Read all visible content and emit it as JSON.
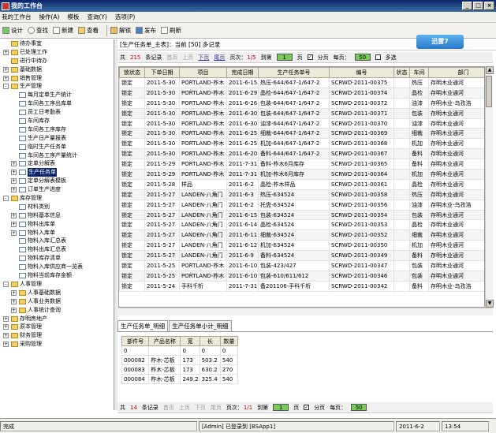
{
  "window": {
    "title": "我的工作台"
  },
  "menu": [
    "我的工作台",
    "操作(A)",
    "模板",
    "查询(Y)",
    "选项(P)"
  ],
  "toolbar": {
    "buttons": [
      {
        "label": "设计",
        "icon": "design-icon"
      },
      {
        "label": "查找",
        "icon": "search-icon"
      },
      {
        "label": "新建",
        "icon": "new-doc-icon"
      },
      {
        "label": "查看",
        "icon": "view-icon"
      }
    ],
    "buttons2": [
      {
        "label": "解锁",
        "icon": "unlock-icon"
      },
      {
        "label": "发布",
        "icon": "publish-icon"
      },
      {
        "label": "刷新",
        "icon": "refresh-icon"
      }
    ]
  },
  "sidebar": {
    "items": [
      {
        "label": "待办事宜",
        "level": 0,
        "type": "folder",
        "expand": ""
      },
      {
        "label": "已处理工作",
        "level": 0,
        "type": "folder",
        "expand": "+"
      },
      {
        "label": "进行中待办",
        "level": 0,
        "type": "folder",
        "expand": ""
      },
      {
        "label": "基础数据",
        "level": 0,
        "type": "folder",
        "expand": "+"
      },
      {
        "label": "销售管理",
        "level": 0,
        "type": "folder",
        "expand": "+"
      },
      {
        "label": "生产管理",
        "level": 0,
        "type": "folder",
        "expand": "-"
      },
      {
        "label": "每月定单生产统计",
        "level": 1,
        "type": "doc",
        "expand": ""
      },
      {
        "label": "车间各工序出库单",
        "level": 1,
        "type": "doc",
        "expand": ""
      },
      {
        "label": "员工日考勤表",
        "level": 1,
        "type": "doc",
        "expand": ""
      },
      {
        "label": "车间库存",
        "level": 1,
        "type": "doc",
        "expand": ""
      },
      {
        "label": "车间各工序库存",
        "level": 1,
        "type": "doc",
        "expand": ""
      },
      {
        "label": "生产日产量报表",
        "level": 1,
        "type": "doc",
        "expand": ""
      },
      {
        "label": "临时生产任务单",
        "level": 1,
        "type": "doc",
        "expand": ""
      },
      {
        "label": "车间各工序产量统计",
        "level": 1,
        "type": "doc",
        "expand": ""
      },
      {
        "label": "定单分解表",
        "level": 1,
        "type": "doc",
        "expand": "+"
      },
      {
        "label": "生产任务单",
        "level": 1,
        "type": "doc",
        "expand": "+",
        "selected": true
      },
      {
        "label": "定单分解表模板",
        "level": 1,
        "type": "doc",
        "expand": "+"
      },
      {
        "label": "订单生产进度",
        "level": 1,
        "type": "doc",
        "expand": "+"
      },
      {
        "label": "库存管理",
        "level": 0,
        "type": "folder",
        "expand": "-"
      },
      {
        "label": "材料类别",
        "level": 1,
        "type": "doc",
        "expand": ""
      },
      {
        "label": "物料基本信息",
        "level": 1,
        "type": "doc",
        "expand": "+"
      },
      {
        "label": "物料出库单",
        "level": 1,
        "type": "doc",
        "expand": "+"
      },
      {
        "label": "物料入库单",
        "level": 1,
        "type": "doc",
        "expand": "+"
      },
      {
        "label": "物料入库汇总表",
        "level": 1,
        "type": "doc",
        "expand": ""
      },
      {
        "label": "物料出库汇总表",
        "level": 1,
        "type": "doc",
        "expand": ""
      },
      {
        "label": "物料库存清单",
        "level": 1,
        "type": "doc",
        "expand": ""
      },
      {
        "label": "物料入库供应商一览表",
        "level": 1,
        "type": "doc",
        "expand": ""
      },
      {
        "label": "物料当前库存金额",
        "level": 1,
        "type": "doc",
        "expand": ""
      },
      {
        "label": "人事管理",
        "level": 0,
        "type": "folder",
        "expand": "-"
      },
      {
        "label": "人事基础数据",
        "level": 1,
        "type": "folder",
        "expand": "+"
      },
      {
        "label": "人事业务数据",
        "level": 1,
        "type": "folder",
        "expand": "+"
      },
      {
        "label": "人事统计查询",
        "level": 1,
        "type": "folder",
        "expand": "+"
      },
      {
        "label": "存明房地产",
        "level": 0,
        "type": "folder",
        "expand": "+"
      },
      {
        "label": "原本管理",
        "level": 0,
        "type": "folder",
        "expand": "+"
      },
      {
        "label": "财务管理",
        "level": 0,
        "type": "folder",
        "expand": "+"
      },
      {
        "label": "采购管理",
        "level": 0,
        "type": "folder",
        "expand": "+"
      }
    ]
  },
  "main": {
    "header": "[生产任务单_主表]：当前 [50] 多记录",
    "logo": "迅雷7",
    "pager": {
      "total_label": "共",
      "total": "215",
      "records_label": "条记录",
      "first": "首页",
      "prev": "上页",
      "next": "下页",
      "last": "尾页",
      "page_label": "页次：",
      "page": "1/5",
      "goto": "到第",
      "goto_val": "1",
      "page_unit": "页",
      "paginate": "分页",
      "per_page_label": "每页：",
      "per_page": "50",
      "multi": "多选"
    },
    "columns": [
      "锁状态",
      "下单日期",
      "项目",
      "完成日期",
      "生产任务单号",
      "编号",
      "状态",
      "车间",
      "部门"
    ],
    "rows": [
      [
        "锁定",
        "2011-5-30",
        "PORTLAND-柞木",
        "2011-6-15",
        "热压-644/647-1/647-2",
        "SCRWD-2011-00375",
        "",
        "热压",
        "存明木业通河"
      ],
      [
        "锁定",
        "2011-5-30",
        "PORTLAND-柞木",
        "2011-6-29",
        "晶检-644/647-1/647-2",
        "SCRWD-2011-00374",
        "",
        "晶检",
        "存明木业通河"
      ],
      [
        "锁定",
        "2011-5-30",
        "PORTLAND-柞木",
        "2011-6-26",
        "包装-644/647-1/647-2",
        "SCRWD-2011-00372",
        "",
        "油漆",
        "存明木业-乌孜浩"
      ],
      [
        "锁定",
        "2011-5-30",
        "PORTLAND-柞木",
        "2011-6-30",
        "包装-644/647-1/647-2",
        "SCRWD-2011-00371",
        "",
        "包装",
        "存明木业通河"
      ],
      [
        "锁定",
        "2011-5-30",
        "PORTLAND-柞木",
        "2011-6-30",
        "油漆-644/647-1/647-2",
        "SCRWD-2011-00370",
        "",
        "油漆",
        "存明木业通河"
      ],
      [
        "锁定",
        "2011-5-30",
        "PORTLAND-柞木",
        "2011-6-25",
        "细裁-644/647-1/647-2",
        "SCRWD-2011-00369",
        "",
        "细裁",
        "存明木业通河"
      ],
      [
        "锁定",
        "2011-5-30",
        "PORTLAND-柞木",
        "2011-6-25",
        "机加-644/647-1/647-2",
        "SCRWD-2011-00368",
        "",
        "机加",
        "存明木业通河"
      ],
      [
        "锁定",
        "2011-5-30",
        "PORTLAND-柞木",
        "2011-6-20",
        "备料-644/647-1/647-2",
        "SCRWD-2011-00367",
        "",
        "备料",
        "存明木业通河"
      ],
      [
        "锁定",
        "2011-5-29",
        "PORTLAND-柞木",
        "2011-7-31",
        "备料-柞木6月库存",
        "SCRWD-2011-00365",
        "",
        "备料",
        "存明木业通河"
      ],
      [
        "锁定",
        "2011-5-29",
        "PORTLAND-柞木",
        "2011-7-31",
        "机加-柞木6月库存",
        "SCRWD-2011-00364",
        "",
        "机加",
        "存明木业通河"
      ],
      [
        "锁定",
        "2011-5-28",
        "样品",
        "2011-6-2",
        "晶检-柞木样品",
        "SCRWD-2011-00361",
        "",
        "晶检",
        "存明木业通河"
      ],
      [
        "锁定",
        "2011-5-27",
        "LANDEN-八角门",
        "2011-6-3",
        "热压-634524",
        "SCRWD-2011-00358",
        "",
        "热压",
        "存明木业通河"
      ],
      [
        "锁定",
        "2011-5-27",
        "LANDEN-八角门",
        "2011-6-2",
        "托盘-634524",
        "SCRWD-2011-00356",
        "",
        "油漆",
        "存明木业-乌孜浩"
      ],
      [
        "锁定",
        "2011-5-27",
        "LANDEN-八角门",
        "2011-6-15",
        "包装-634524",
        "SCRWD-2011-00354",
        "",
        "包装",
        "存明木业通河"
      ],
      [
        "锁定",
        "2011-5-27",
        "LANDEN-八角门",
        "2011-6-14",
        "晶检-634524",
        "SCRWD-2011-00353",
        "",
        "晶检",
        "存明木业通河"
      ],
      [
        "锁定",
        "2011-5-27",
        "LANDEN-八角门",
        "2011-6-11",
        "细裁-634524",
        "SCRWD-2011-00352",
        "",
        "细裁",
        "存明木业通河"
      ],
      [
        "锁定",
        "2011-5-27",
        "LANDEN-八角门",
        "2011-6-12",
        "机加-634524",
        "SCRWD-2011-00350",
        "",
        "机加",
        "存明木业通河"
      ],
      [
        "锁定",
        "2011-5-27",
        "LANDEN-八角门",
        "2011-6-9",
        "备料-634524",
        "SCRWD-2011-00349",
        "",
        "备料",
        "存明木业通河"
      ],
      [
        "锁定",
        "2011-5-25",
        "PORTLAND-柞木",
        "2011-6-10",
        "包装-423/427",
        "SCRWD-2011-00347",
        "",
        "包装",
        "存明木业通河"
      ],
      [
        "锁定",
        "2011-5-25",
        "PORTLAND-柞木",
        "2011-6-10",
        "包装-610/611/612",
        "SCRWD-2011-00346",
        "",
        "包装",
        "存明木业通河"
      ],
      [
        "锁定",
        "2011-5-24",
        "手科千析",
        "2011-7-31",
        "备201106-手科千析",
        "SCRWD-2011-00342",
        "",
        "备料",
        "存明木业-乌孜浩"
      ]
    ]
  },
  "detail": {
    "tabs": [
      "生产任务单_明细",
      "生产任务单小计_明细"
    ],
    "columns": [
      "部件号",
      "产品名称",
      "宽",
      "长",
      "数量"
    ],
    "rows": [
      [
        "0",
        "",
        "0",
        "0",
        "0"
      ],
      [
        "000082",
        "柞木-芯板",
        "173",
        "503.2",
        "540"
      ],
      [
        "000083",
        "柞木-芯板",
        "173",
        "630.2",
        "270"
      ],
      [
        "000084",
        "柞木-芯板",
        "249.2",
        "325.4",
        "540"
      ]
    ],
    "pager": {
      "total_label": "共",
      "total": "14",
      "records_label": "条记录",
      "first": "首页",
      "prev": "上页",
      "next": "下页",
      "last": "尾页",
      "page_label": "页次：",
      "page": "1/1",
      "goto": "到第",
      "goto_val": "1",
      "page_unit": "页",
      "paginate": "分页",
      "per_page_label": "每页：",
      "per_page": "50"
    }
  },
  "status": {
    "left": "完成",
    "user": "[Admin] 已登录到 [BSApp1]",
    "date": "2011-6-2",
    "time": "13:54"
  }
}
